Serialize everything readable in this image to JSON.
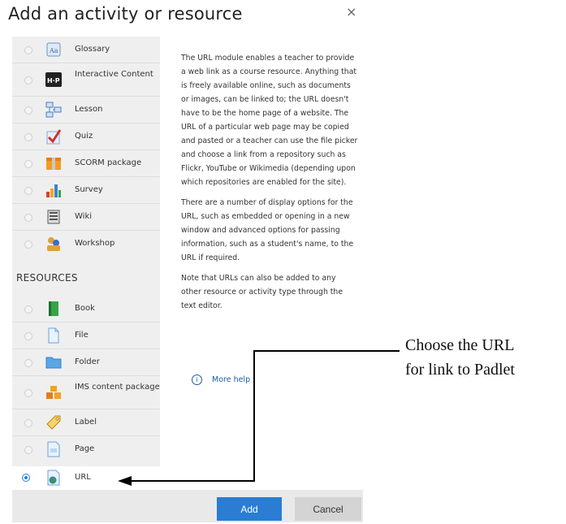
{
  "dialog": {
    "title": "Add an activity or resource",
    "close_glyph": "×"
  },
  "activities": [
    {
      "label": "Glossary",
      "icon": "glossary-icon"
    },
    {
      "label": "Interactive Content",
      "icon": "hp-icon"
    },
    {
      "label": "Lesson",
      "icon": "lesson-icon"
    },
    {
      "label": "Quiz",
      "icon": "quiz-icon"
    },
    {
      "label": "SCORM package",
      "icon": "scorm-icon"
    },
    {
      "label": "Survey",
      "icon": "survey-icon"
    },
    {
      "label": "Wiki",
      "icon": "wiki-icon"
    },
    {
      "label": "Workshop",
      "icon": "workshop-icon"
    }
  ],
  "resources_header": "RESOURCES",
  "resources": [
    {
      "label": "Book",
      "icon": "book-icon"
    },
    {
      "label": "File",
      "icon": "file-icon"
    },
    {
      "label": "Folder",
      "icon": "folder-icon"
    },
    {
      "label": "IMS content package",
      "icon": "ims-icon"
    },
    {
      "label": "Label",
      "icon": "label-icon"
    },
    {
      "label": "Page",
      "icon": "page-icon"
    },
    {
      "label": "URL",
      "icon": "url-icon",
      "selected": true
    }
  ],
  "description": {
    "p1": "The URL module enables a teacher to provide a web link as a course resource. Anything that is freely available online, such as documents or images, can be linked to; the URL doesn't have to be the home page of a website. The URL of a particular web page may be copied and pasted or a teacher can use the file picker and choose a link from a repository such as Flickr, YouTube or Wikimedia (depending upon which repositories are enabled for the site).",
    "p2": "There are a number of display options for the URL, such as embedded or opening in a new window and advanced options for passing information, such as a student's name, to the URL if required.",
    "p3": "Note that URLs can also be added to any other resource or activity type through the text editor.",
    "more_help": "More help",
    "info_glyph": "i"
  },
  "footer": {
    "add_label": "Add",
    "cancel_label": "Cancel"
  },
  "annotation": {
    "line1": "Choose the URL",
    "line2": "for link to Padlet"
  }
}
